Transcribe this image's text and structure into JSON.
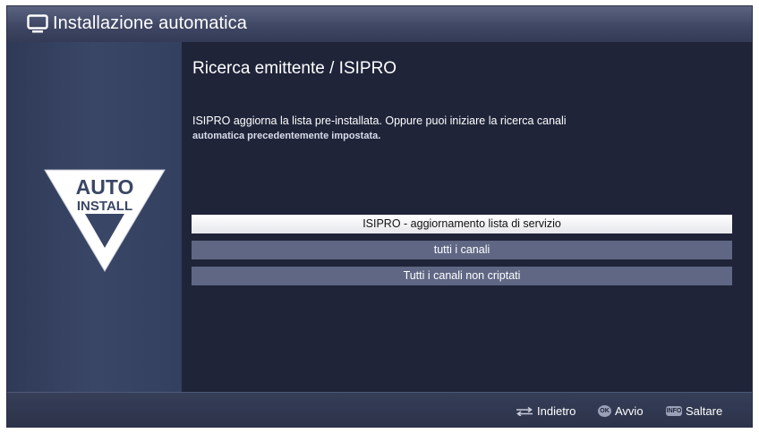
{
  "header": {
    "title": "Installazione automatica",
    "icon": "tv-icon"
  },
  "badge": {
    "line1": "AUTO",
    "line2": "INSTALL",
    "icon": "auto-install-icon"
  },
  "main": {
    "subtitle": "Ricerca emittente / ISIPRO",
    "description_line1": "ISIPRO aggiorna la lista pre-installata. Oppure puoi iniziare la ricerca canali",
    "description_line2": "automatica precedentemente impostata.",
    "options": [
      {
        "label": "ISIPRO - aggiornamento lista di servizio",
        "selected": true
      },
      {
        "label": "tutti i canali",
        "selected": false
      },
      {
        "label": "Tutti i canali non criptati",
        "selected": false
      }
    ]
  },
  "footer": {
    "back_label": "Indietro",
    "start_key": "OK",
    "start_label": "Avvio",
    "skip_key": "INFO",
    "skip_label": "Saltare"
  },
  "colors": {
    "background": "#1e2338",
    "header": "#464e6b",
    "panel": "#36425f",
    "option_selected": "#ffffff",
    "option": "#5f6784"
  }
}
